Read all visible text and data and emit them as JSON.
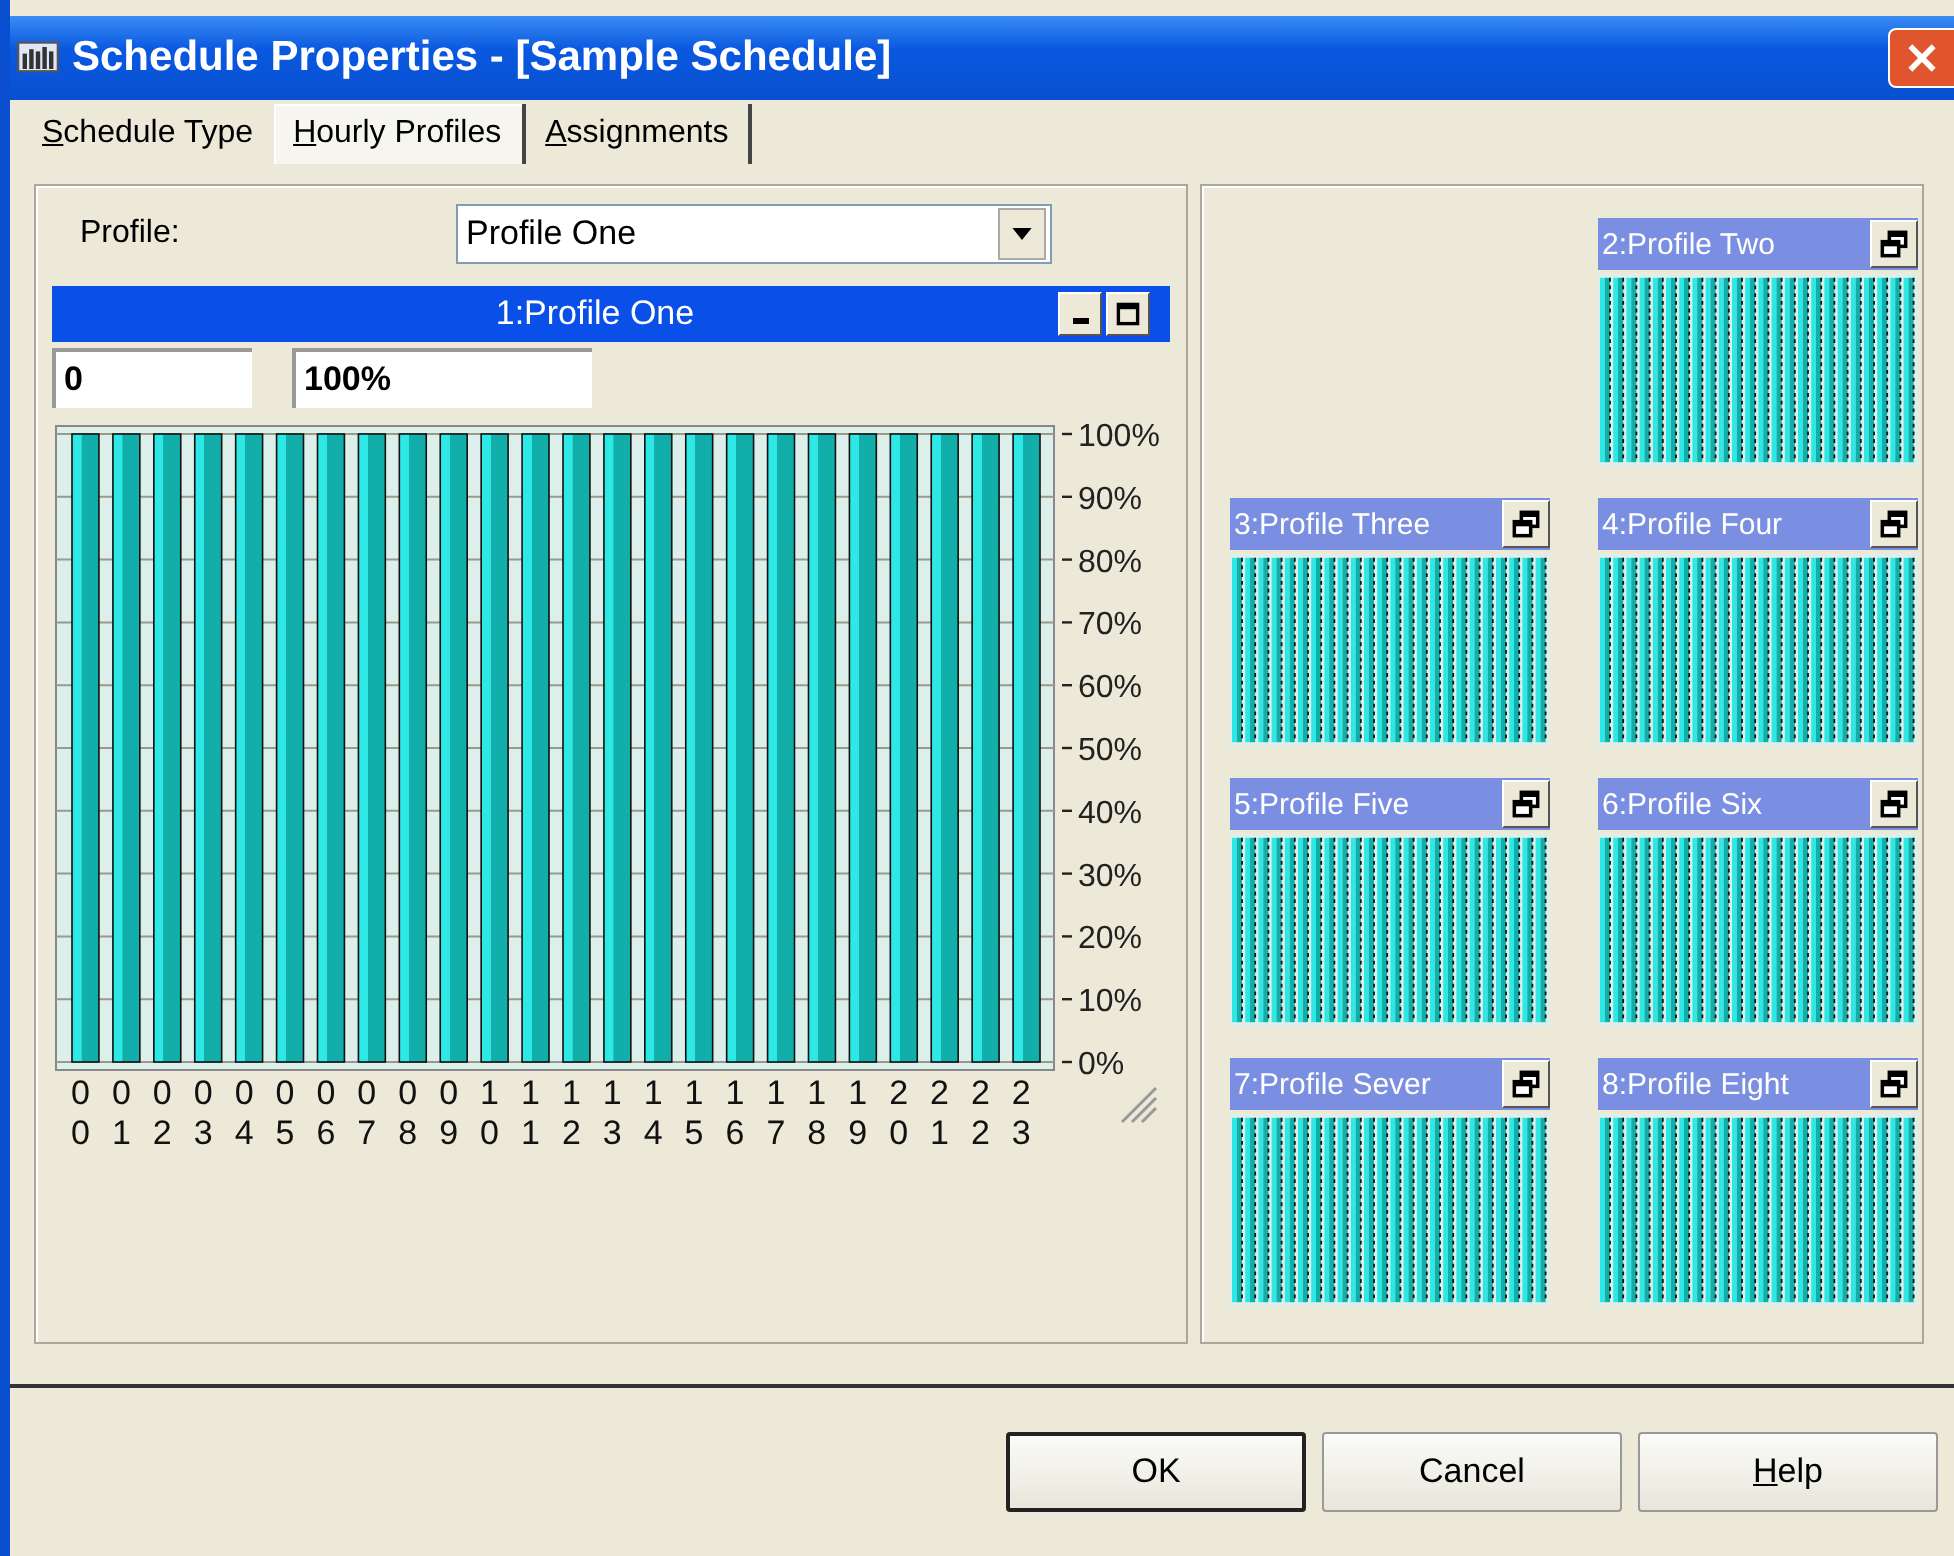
{
  "window": {
    "title": "Schedule Properties - [Sample Schedule]"
  },
  "tabs": [
    {
      "label": "Schedule Type",
      "selected": false,
      "mnemonic": true
    },
    {
      "label": "Hourly Profiles",
      "selected": true,
      "mnemonic": true
    },
    {
      "label": "Assignments",
      "selected": false,
      "mnemonic": true
    }
  ],
  "profile_picker": {
    "label": "Profile:",
    "value": "Profile One"
  },
  "profile_window": {
    "title": "1:Profile One",
    "range_min": "0",
    "range_max": "100%",
    "chart_data": {
      "type": "bar",
      "categories": [
        "00",
        "01",
        "02",
        "03",
        "04",
        "05",
        "06",
        "07",
        "08",
        "09",
        "10",
        "11",
        "12",
        "13",
        "14",
        "15",
        "16",
        "17",
        "18",
        "19",
        "20",
        "21",
        "22",
        "23"
      ],
      "values": [
        100,
        100,
        100,
        100,
        100,
        100,
        100,
        100,
        100,
        100,
        100,
        100,
        100,
        100,
        100,
        100,
        100,
        100,
        100,
        100,
        100,
        100,
        100,
        100
      ],
      "ylim": [
        0,
        100
      ],
      "grid": true,
      "yticks": [
        {
          "value": 0,
          "label": "0%"
        },
        {
          "value": 10,
          "label": "10%"
        },
        {
          "value": 20,
          "label": "20%"
        },
        {
          "value": 30,
          "label": "30%"
        },
        {
          "value": 40,
          "label": "40%"
        },
        {
          "value": 50,
          "label": "50%"
        },
        {
          "value": 60,
          "label": "60%"
        },
        {
          "value": 70,
          "label": "70%"
        },
        {
          "value": 80,
          "label": "80%"
        },
        {
          "value": 90,
          "label": "90%"
        },
        {
          "value": 100,
          "label": "100%"
        }
      ]
    }
  },
  "mini_windows": [
    {
      "title": "2:Profile Two"
    },
    {
      "title": "3:Profile Three"
    },
    {
      "title": "4:Profile Four"
    },
    {
      "title": "5:Profile Five"
    },
    {
      "title": "6:Profile Six"
    },
    {
      "title": "7:Profile Sever"
    },
    {
      "title": "8:Profile Eight"
    }
  ],
  "buttons": [
    {
      "label": "OK",
      "default": true,
      "mnemonic": false
    },
    {
      "label": "Cancel",
      "default": false,
      "mnemonic": false
    },
    {
      "label": "Help",
      "default": false,
      "mnemonic": true
    }
  ]
}
